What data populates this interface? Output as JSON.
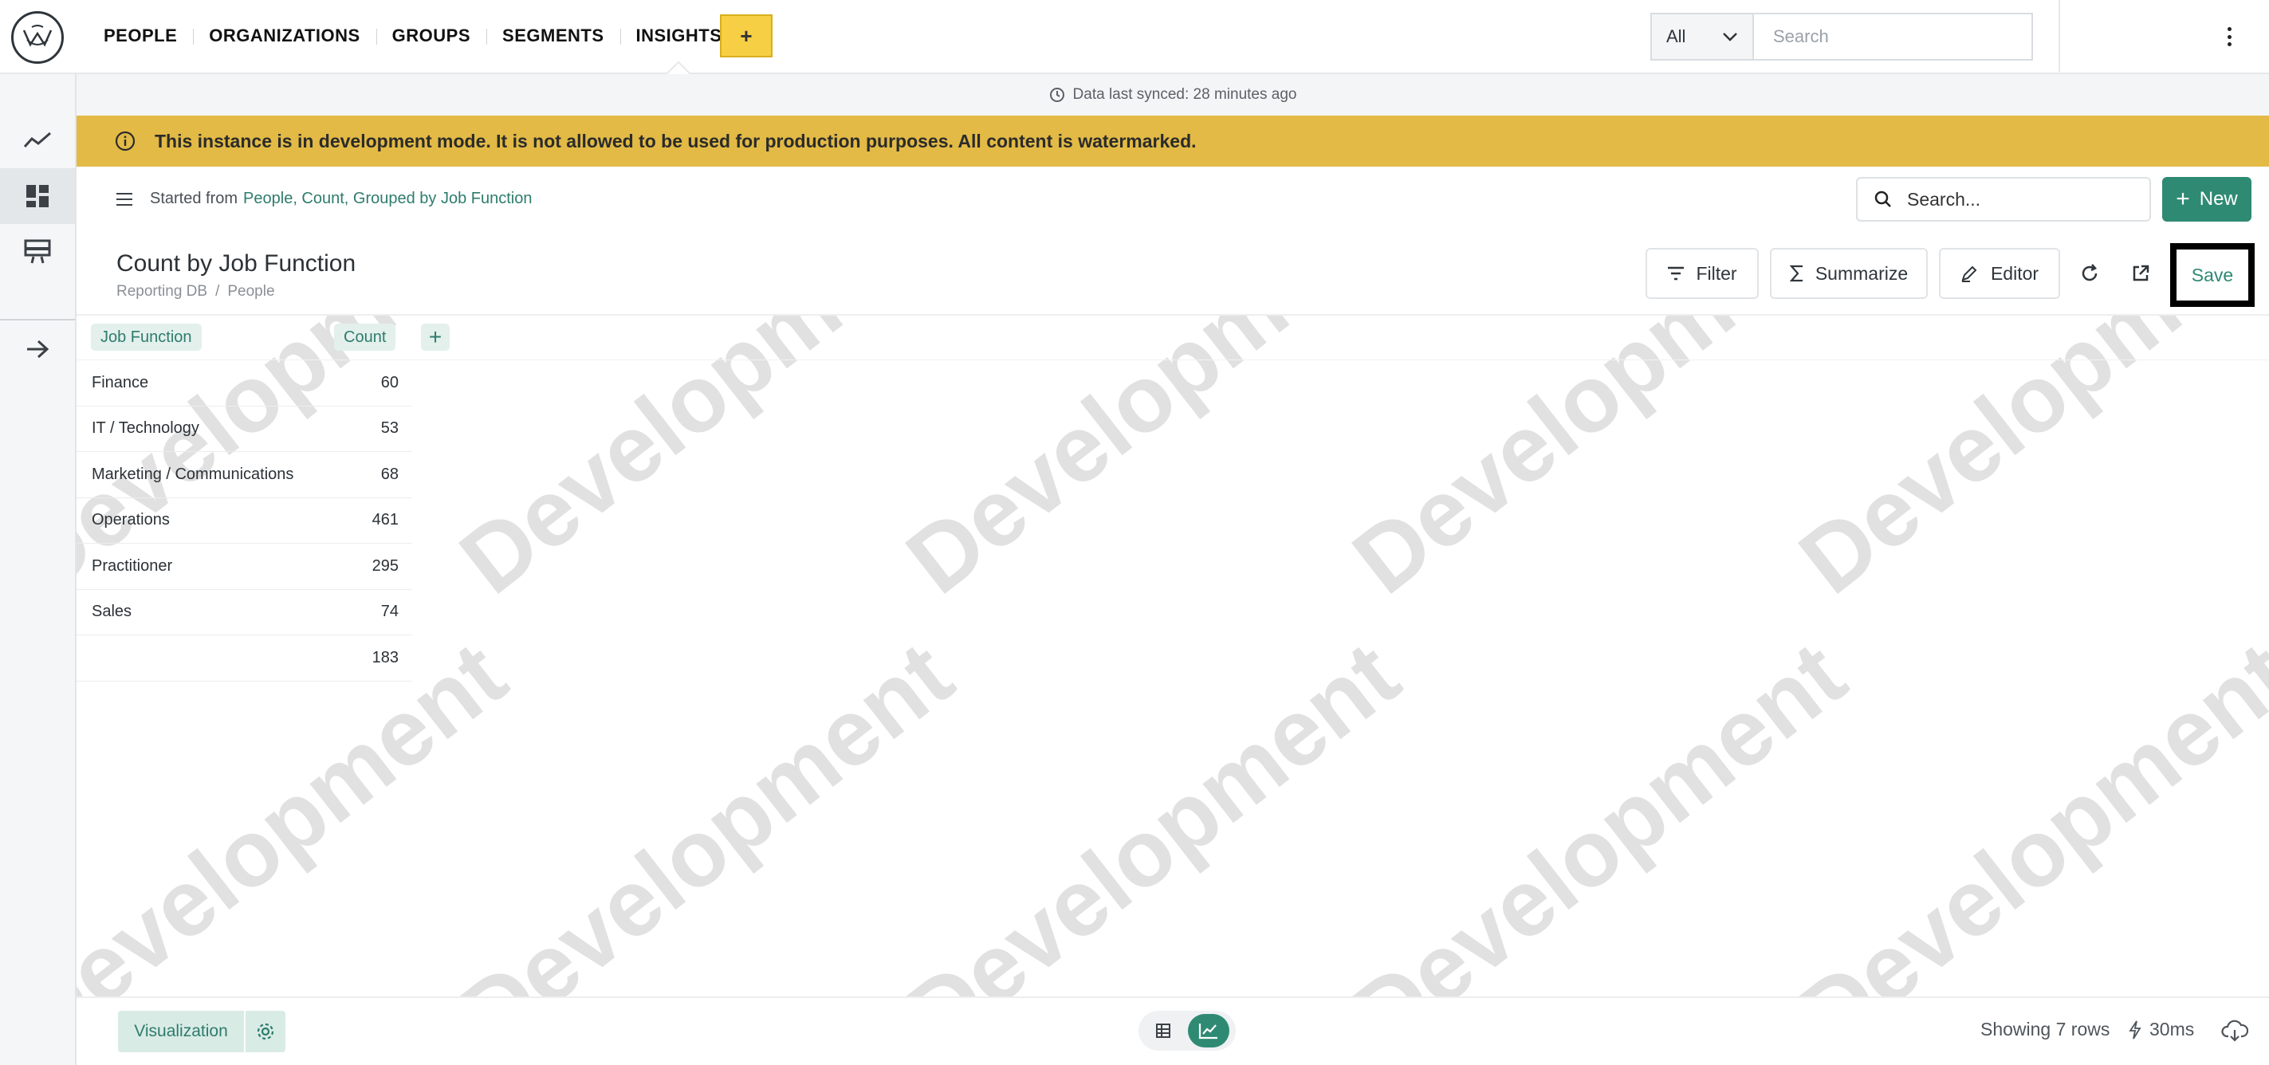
{
  "nav": {
    "items": [
      {
        "label": "PEOPLE"
      },
      {
        "label": "ORGANIZATIONS"
      },
      {
        "label": "GROUPS"
      },
      {
        "label": "SEGMENTS"
      },
      {
        "label": "INSIGHTS"
      }
    ],
    "active": "INSIGHTS",
    "add_label": "+",
    "scope_value": "All",
    "search_placeholder": "Search"
  },
  "sidebar": {
    "icons": [
      "line-chart-icon",
      "dashboard-icon",
      "presentation-icon",
      "arrow-right-icon"
    ]
  },
  "sync": {
    "text": "Data last synced: 28 minutes ago"
  },
  "banner": {
    "text": "This instance is in development mode. It is not allowed to be used for production purposes. All content is watermarked."
  },
  "query": {
    "started_prefix": "Started from",
    "started_link": "People, Count, Grouped by Job Function",
    "search_placeholder": "Search...",
    "new_label": "New",
    "title": "Count by Job Function",
    "breadcrumb": [
      "Reporting DB",
      "People"
    ],
    "filter_label": "Filter",
    "summarize_label": "Summarize",
    "editor_label": "Editor",
    "save_label": "Save"
  },
  "table": {
    "columns": [
      "Job Function",
      "Count"
    ],
    "rows": [
      {
        "job": "Finance",
        "count": "60"
      },
      {
        "job": "IT / Technology",
        "count": "53"
      },
      {
        "job": "Marketing / Communications",
        "count": "68"
      },
      {
        "job": "Operations",
        "count": "461"
      },
      {
        "job": "Practitioner",
        "count": "295"
      },
      {
        "job": "Sales",
        "count": "74"
      },
      {
        "job": "",
        "count": "183"
      }
    ]
  },
  "watermark": {
    "text": "Development"
  },
  "footer": {
    "visualization_label": "Visualization",
    "row_count": "Showing 7 rows",
    "timing": "30ms"
  },
  "colors": {
    "accent": "#2f8a73",
    "banner": "#e2ba45",
    "nav_add": "#f7cf45"
  }
}
